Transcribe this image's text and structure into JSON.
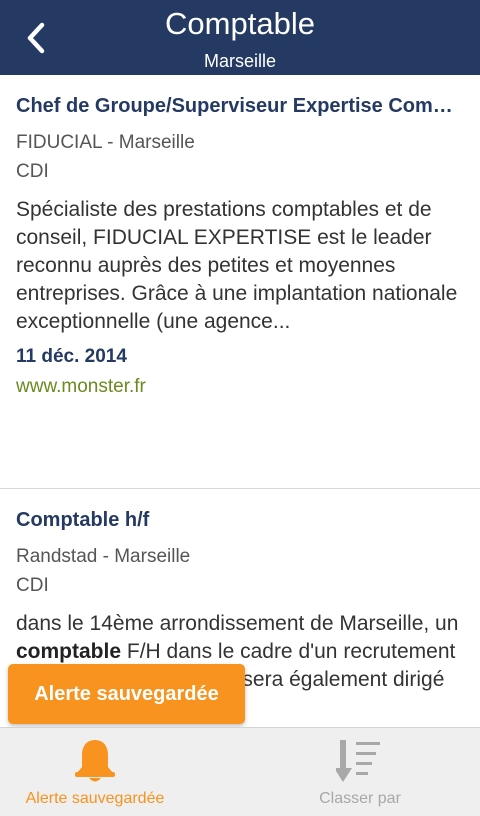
{
  "header": {
    "title": "Comptable",
    "subtitle": "Marseille",
    "back_icon": "chevron-left-icon"
  },
  "jobs": [
    {
      "title": "Chef de Groupe/Superviseur Expertise Comptable",
      "company": "FIDUCIAL - Marseille",
      "contract": "CDI",
      "description": "Spécialiste des prestations comptables et de conseil, FIDUCIAL EXPERTISE est le leader reconnu auprès des petites et moyennes entreprises. Grâce à une implantation nationale exceptionnelle (une agence...",
      "date": "11 déc. 2014",
      "source": "www.monster.fr"
    },
    {
      "title": "Comptable h/f",
      "company": "Randstad - Marseille",
      "contract": "CDI",
      "description_parts": [
        "dans le 14ème arrondissement de Marseille, un ",
        "comptable",
        " F/H dans le cadre d'un recrutement CDI... fiscales, ce poste sera également dirigé ensuite par"
      ]
    }
  ],
  "toast": {
    "text": "Alerte sauvegardée"
  },
  "bottom_tabs": [
    {
      "label": "Alerte sauvegardée",
      "icon": "bell-icon",
      "color": "#f7931e"
    },
    {
      "label": "Classer par",
      "icon": "sort-icon",
      "color": "#a8a8a8"
    }
  ],
  "colors": {
    "header_bg": "#253a62",
    "accent": "#f7931e",
    "source_link": "#6a8a1e"
  }
}
